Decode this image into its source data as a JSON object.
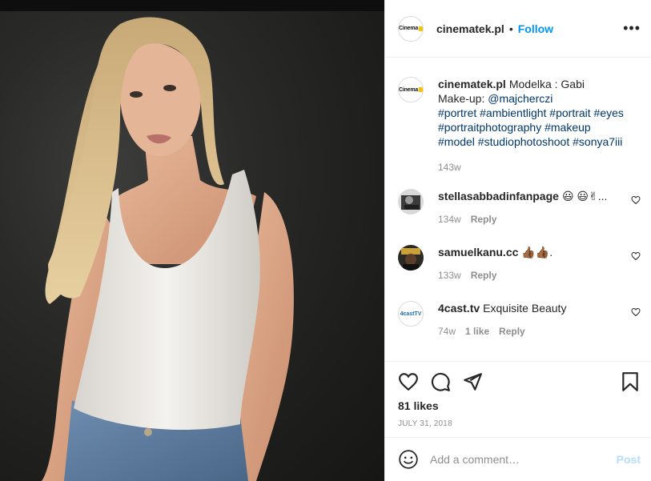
{
  "post": {
    "image_alt": "Portrait of a model in a white tank top against a dark background",
    "colors": {
      "link": "#0095f6",
      "hashtag": "#00376b",
      "muted": "#8e8e8e",
      "post_disabled": "#b2dffc"
    }
  },
  "header": {
    "avatar_icon": "cinematek-logo",
    "username": "cinematek.pl",
    "separator": "•",
    "follow_label": "Follow",
    "more_icon": "more-options-icon",
    "more_glyph": "•••"
  },
  "caption": {
    "username": "cinematek.pl",
    "lines": [
      "Modelka : Gabi",
      "Make-up: ",
      "@majcherczi",
      "#portret #ambientlight #portrait #eyes",
      "#portraitphotography #makeup",
      "#model #studiophotoshoot #sonya7iii"
    ],
    "time": "143w"
  },
  "comments": [
    {
      "username": "stellasabbadinfanpage",
      "text": "😃 😃✌...",
      "time": "134w",
      "likes": "",
      "reply_label": "Reply"
    },
    {
      "username": "samuelkanu.cc",
      "text": "👍🏾👍🏾.",
      "time": "133w",
      "likes": "",
      "reply_label": "Reply"
    },
    {
      "username": "4cast.tv",
      "text": "Exquisite Beauty",
      "time": "74w",
      "likes": "1 like",
      "reply_label": "Reply"
    }
  ],
  "actions": {
    "like_icon": "heart-icon",
    "comment_icon": "comment-icon",
    "share_icon": "share-icon",
    "save_icon": "bookmark-icon"
  },
  "likes_label": "81 likes",
  "date_label": "July 31, 2018",
  "add_comment": {
    "placeholder": "Add a comment…",
    "post_label": "Post",
    "emoji_icon": "emoji-icon"
  },
  "logo_text": {
    "cinematek": "Cinema",
    "fourcast": "4castTV"
  }
}
